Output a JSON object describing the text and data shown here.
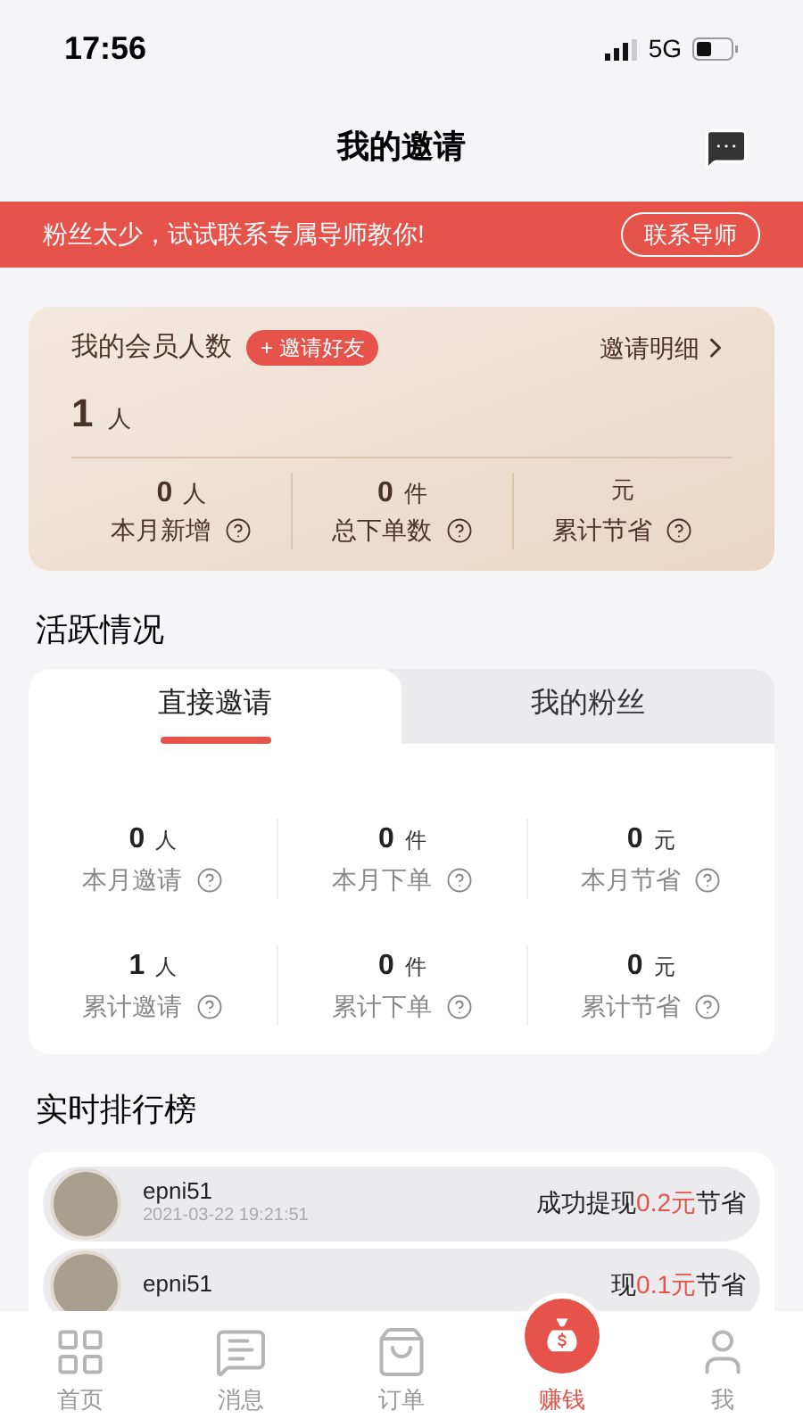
{
  "status_bar": {
    "time": "17:56",
    "network": "5G"
  },
  "header": {
    "title": "我的邀请"
  },
  "banner": {
    "text": "粉丝太少，试试联系专属导师教你!",
    "button": "联系导师"
  },
  "member_card": {
    "title": "我的会员人数",
    "invite_button": "+ 邀请好友",
    "detail_link": "邀请明细",
    "count": "1",
    "count_unit": "人",
    "stats": [
      {
        "value": "0",
        "unit": "人",
        "label": "本月新增"
      },
      {
        "value": "0",
        "unit": "件",
        "label": "总下单数"
      },
      {
        "unit": "元",
        "label": "累计节省"
      }
    ]
  },
  "activity": {
    "title": "活跃情况",
    "tabs": [
      {
        "label": "直接邀请",
        "selected": true
      },
      {
        "label": "我的粉丝",
        "selected": false
      }
    ],
    "stats": [
      {
        "value": "0",
        "unit": "人",
        "label": "本月邀请"
      },
      {
        "value": "0",
        "unit": "件",
        "label": "本月下单"
      },
      {
        "value": "0",
        "unit": "元",
        "label": "本月节省"
      },
      {
        "value": "1",
        "unit": "人",
        "label": "累计邀请"
      },
      {
        "value": "0",
        "unit": "件",
        "label": "累计下单"
      },
      {
        "value": "0",
        "unit": "元",
        "label": "累计节省"
      }
    ]
  },
  "ranking": {
    "title": "实时排行榜",
    "rows": [
      {
        "name": "epni51",
        "time": "2021-03-22 19:21:51",
        "prefix": "成功提现",
        "amount": "0.2元",
        "suffix": "节省"
      },
      {
        "name": "epni51",
        "prefix": "现",
        "amount": "0.1元",
        "suffix": "节省"
      }
    ]
  },
  "tab_bar": [
    {
      "kind": "home",
      "label": "首页",
      "selected": false
    },
    {
      "kind": "messages",
      "label": "消息",
      "selected": false
    },
    {
      "kind": "orders",
      "label": "订单",
      "selected": false
    },
    {
      "kind": "earn",
      "label": "赚钱",
      "selected": true
    },
    {
      "kind": "me",
      "label": "我",
      "selected": false
    }
  ]
}
